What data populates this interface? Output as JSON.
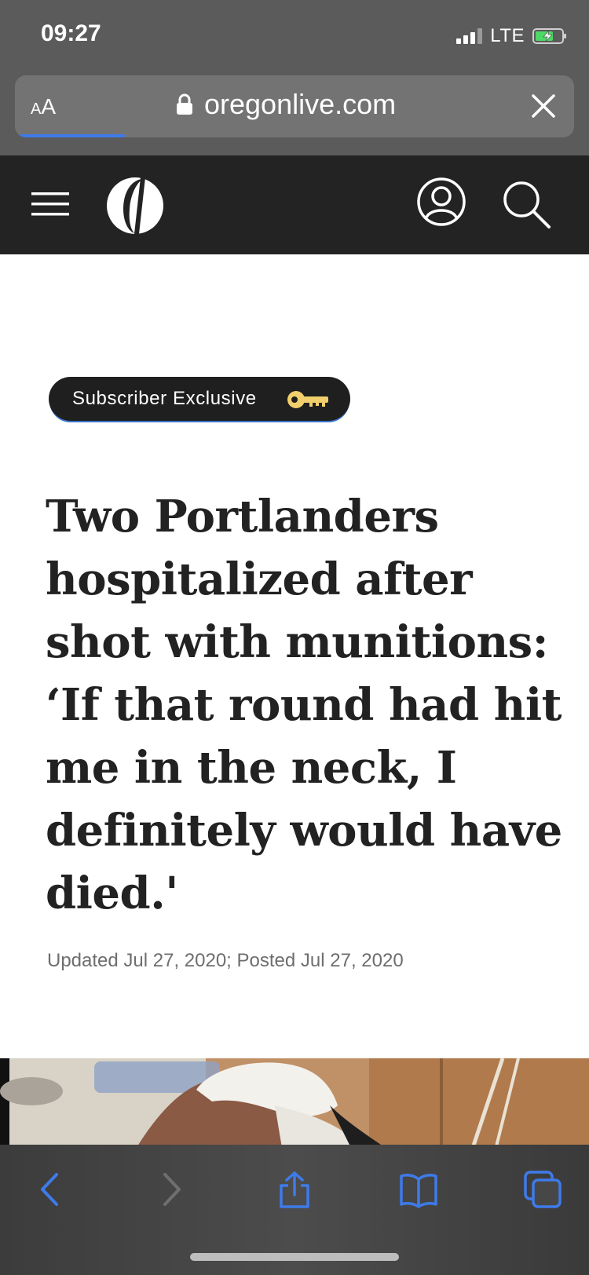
{
  "status_bar": {
    "time": "09:27",
    "network": "LTE",
    "battery_charging": true
  },
  "browser": {
    "text_size_label_small": "A",
    "text_size_label_large": "A",
    "url": "oregonlive.com"
  },
  "site_header": {
    "logo_icon": "oregonian-o-logo",
    "menu_icon": "hamburger-menu-icon",
    "account_icon": "account-icon",
    "search_icon": "search-icon"
  },
  "article": {
    "badge_label": "Subscriber Exclusive",
    "badge_icon": "key-icon",
    "headline": "Two Portlanders hospitalized after shot with munitions: ‘If that round had hit me in the neck, I definitely would have died.'",
    "dateline": "Updated Jul 27, 2020; Posted Jul 27, 2020"
  },
  "toolbar": {
    "items": [
      "back-icon",
      "forward-icon",
      "share-icon",
      "bookmarks-icon",
      "tabs-icon"
    ]
  },
  "colors": {
    "browser_chrome": "#5b5b5b",
    "site_header": "#232323",
    "accent_blue": "#3e7bea",
    "key_gold": "#f1cf6c",
    "headline_text": "#222222"
  }
}
